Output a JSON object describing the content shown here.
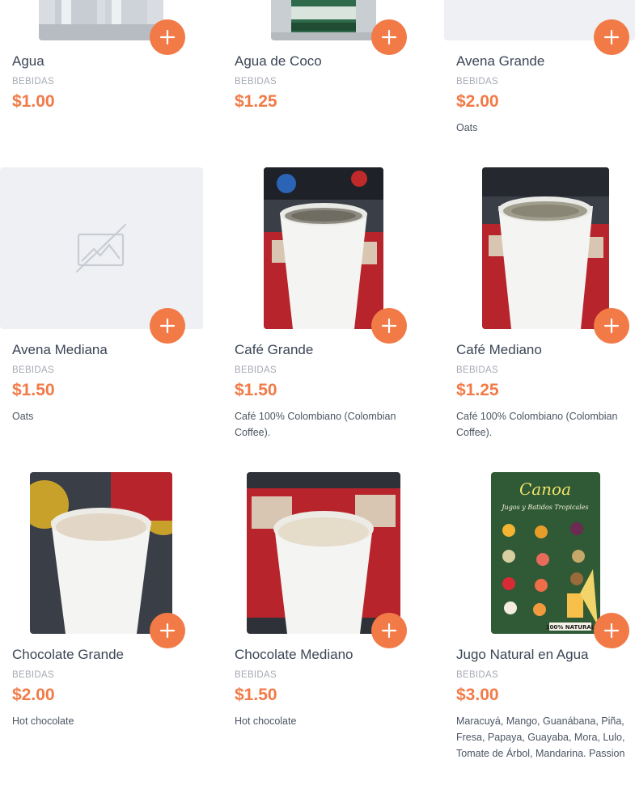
{
  "category_label": "BEBIDAS",
  "items": [
    {
      "name": "Agua",
      "category": "BEBIDAS",
      "price": "$1.00",
      "description": ""
    },
    {
      "name": "Agua de Coco",
      "category": "BEBIDAS",
      "price": "$1.25",
      "description": ""
    },
    {
      "name": "Avena Grande",
      "category": "BEBIDAS",
      "price": "$2.00",
      "description": "Oats"
    },
    {
      "name": "Avena Mediana",
      "category": "BEBIDAS",
      "price": "$1.50",
      "description": "Oats"
    },
    {
      "name": "Café Grande",
      "category": "BEBIDAS",
      "price": "$1.50",
      "description": "Café 100% Colombiano (Colombian Coffee)."
    },
    {
      "name": "Café Mediano",
      "category": "BEBIDAS",
      "price": "$1.25",
      "description": "Café 100% Colombiano (Colombian Coffee)."
    },
    {
      "name": "Chocolate Grande",
      "category": "BEBIDAS",
      "price": "$2.00",
      "description": "Hot chocolate"
    },
    {
      "name": "Chocolate Mediano",
      "category": "BEBIDAS",
      "price": "$1.50",
      "description": "Hot chocolate"
    },
    {
      "name": "Jugo Natural en Agua",
      "category": "BEBIDAS",
      "price": "$3.00",
      "description": "Maracuyá, Mango, Guanábana, Piña, Fresa, Papaya, Guayaba, Mora, Lulo, Tomate de Árbol, Mandarina. Passion"
    }
  ],
  "poster_text": {
    "brand": "Canoa",
    "headline": "Jugos y Batidos Tropicales",
    "badge": "100% NATURAL"
  },
  "colors": {
    "accent": "#f27a47",
    "placeholder_bg": "#eef0f3",
    "title": "#3c4656",
    "muted": "#a5aab4"
  },
  "icons": {
    "add": "plus-icon",
    "no_image": "no-image-icon"
  }
}
